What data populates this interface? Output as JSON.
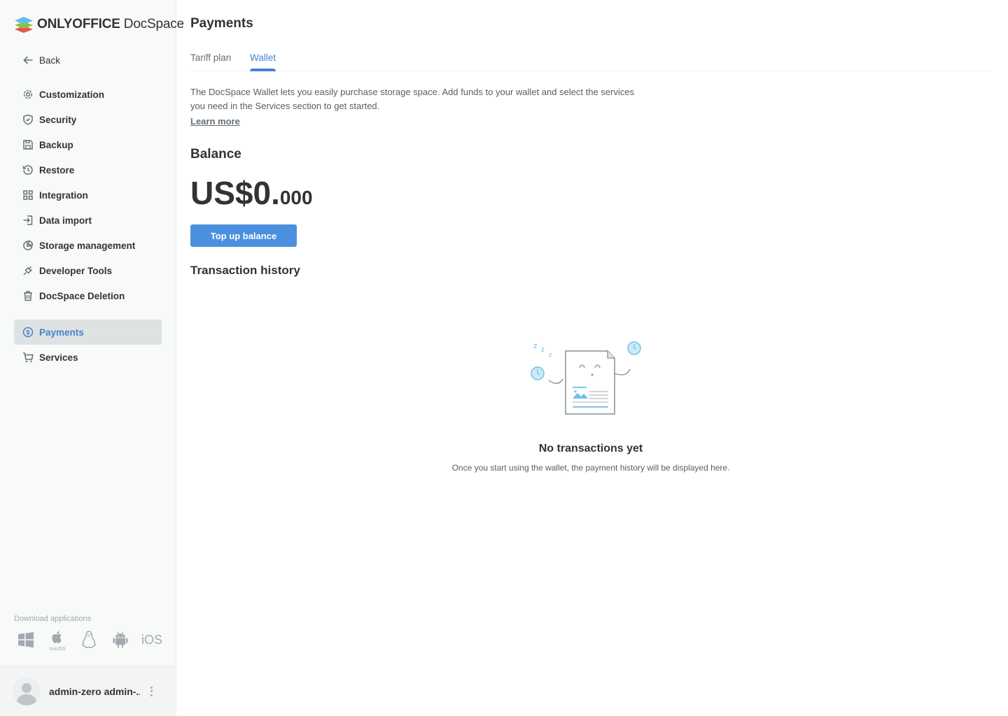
{
  "brand": {
    "name_bold": "ONLYOFFICE",
    "name_regular": "DocSpace",
    "accent": "#4781d1",
    "button_color": "#4a90de"
  },
  "sidebar": {
    "back_label": "Back",
    "items": [
      {
        "label": "Customization",
        "icon": "gear-icon"
      },
      {
        "label": "Security",
        "icon": "shield-icon"
      },
      {
        "label": "Backup",
        "icon": "save-icon"
      },
      {
        "label": "Restore",
        "icon": "history-icon"
      },
      {
        "label": "Integration",
        "icon": "grid-icon"
      },
      {
        "label": "Data import",
        "icon": "import-icon"
      },
      {
        "label": "Storage management",
        "icon": "pie-chart-icon"
      },
      {
        "label": "Developer Tools",
        "icon": "plug-icon"
      },
      {
        "label": "DocSpace Deletion",
        "icon": "trash-icon"
      }
    ],
    "items2": [
      {
        "label": "Payments",
        "icon": "dollar-icon",
        "active": true
      },
      {
        "label": "Services",
        "icon": "cart-icon"
      }
    ],
    "download_label": "Download applications",
    "apps": [
      "windows-icon",
      "macos-icon",
      "linux-icon",
      "android-icon",
      "ios-icon"
    ],
    "macos_caption": "macOS",
    "ios_label": "iOS",
    "user_name": "admin-zero admin-..."
  },
  "main": {
    "title": "Payments",
    "tabs": [
      {
        "label": "Tariff plan",
        "active": false
      },
      {
        "label": "Wallet",
        "active": true
      }
    ],
    "description": "The DocSpace Wallet lets you easily purchase storage space. Add funds to your wallet and select the services you need in the Services section to get started.",
    "learn_more": "Learn more",
    "balance_heading": "Balance",
    "balance_main": "US$0.",
    "balance_fraction": "000",
    "topup_label": "Top up balance",
    "history_heading": "Transaction history",
    "empty_title": "No transactions yet",
    "empty_subtitle": "Once you start using the wallet, the payment history will be displayed here."
  }
}
